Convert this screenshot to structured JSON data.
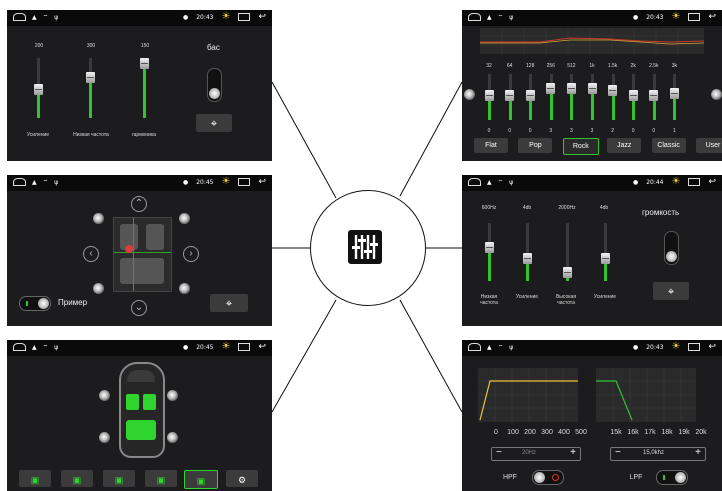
{
  "statusbar": {
    "time_a": "20:43",
    "time_b": "20:45",
    "time_c": "20:44"
  },
  "p1": {
    "values": [
      "200",
      "300",
      "150"
    ],
    "labels": [
      "Усиление",
      "Низкая частота",
      "гармоника"
    ],
    "title": "бас",
    "levels": [
      0.45,
      0.35,
      0.85
    ]
  },
  "p2": {
    "freqs": [
      "32",
      "64",
      "128",
      "256",
      "512",
      "1k",
      "1.5k",
      "2k",
      "2.5k",
      "3k"
    ],
    "gains": [
      "0",
      "0",
      "0",
      "3",
      "3",
      "3",
      "2",
      "0",
      "0",
      "1"
    ],
    "presets": [
      "Flat",
      "Pop",
      "Rock",
      "Jazz",
      "Classic",
      "User"
    ],
    "active_preset": "Rock"
  },
  "p3": {
    "example_label": "Пример"
  },
  "p4": {
    "top_values": [
      "600Hz",
      "4db",
      "2000Hz",
      "4db"
    ],
    "title": "громкость",
    "labels": [
      "Низкая\nчастота",
      "Усиление",
      "Высокая\nчастота",
      "Усиление"
    ]
  },
  "p6": {
    "left_ticks": [
      "0",
      "100",
      "200",
      "300",
      "400",
      "500"
    ],
    "right_ticks": [
      "15k",
      "16k",
      "17k",
      "18k",
      "19k",
      "20k"
    ],
    "hpf_value": "20Hz",
    "lpf_value": "15,0khz",
    "hpf_label": "HPF",
    "lpf_label": "LPF",
    "minus": "−",
    "plus": "+"
  },
  "colors": {
    "accent": "#32c232",
    "panel": "#1c1c1e"
  }
}
